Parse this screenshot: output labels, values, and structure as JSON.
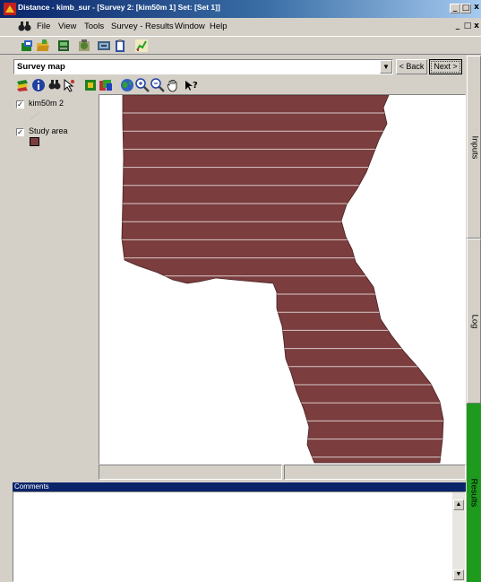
{
  "window": {
    "title": "Distance - kimb_sur - [Survey 2: [kim50m 1] Set: [Set 1]]",
    "caption_buttons": [
      "_",
      "□",
      "x"
    ],
    "child_caption_buttons": [
      "_",
      "□",
      "x"
    ]
  },
  "menu": {
    "items": [
      {
        "label": "File"
      },
      {
        "label": "View"
      },
      {
        "label": "Tools"
      },
      {
        "label": "Survey - Results"
      },
      {
        "label": "Window"
      },
      {
        "label": "Help"
      }
    ]
  },
  "main_toolbar": {
    "icons": [
      "open-project-icon",
      "folder-icon",
      "data-icon",
      "map-icon",
      "model-icon",
      "clipboard-icon",
      "analysis-icon"
    ]
  },
  "selector": {
    "value": "Survey map",
    "back_label": "< Back",
    "next_label": "Next >"
  },
  "map_toolbar": {
    "icons": [
      "layers-icon",
      "info-icon",
      "find-icon",
      "select-icon",
      "theme-icon",
      "palette-icon",
      "globe-icon",
      "zoom-in-icon",
      "zoom-out-icon",
      "pan-hand-icon",
      "help-pointer-icon"
    ]
  },
  "legend": {
    "layers": [
      {
        "label": "kim50m 2",
        "checked": true,
        "swatch_color": "#d6d2c8"
      },
      {
        "label": "Study area",
        "checked": true,
        "swatch_color": "#7b3d3d"
      }
    ]
  },
  "map": {
    "fill_color": "#7b3d3d",
    "line_color": "#d9c9c9"
  },
  "comments": {
    "header": "Comments",
    "text": ""
  },
  "side_tabs": [
    {
      "label": "Inputs",
      "active": false
    },
    {
      "label": "Log",
      "active": false
    },
    {
      "label": "Results",
      "active": true,
      "color": "#1e9b1e"
    }
  ]
}
